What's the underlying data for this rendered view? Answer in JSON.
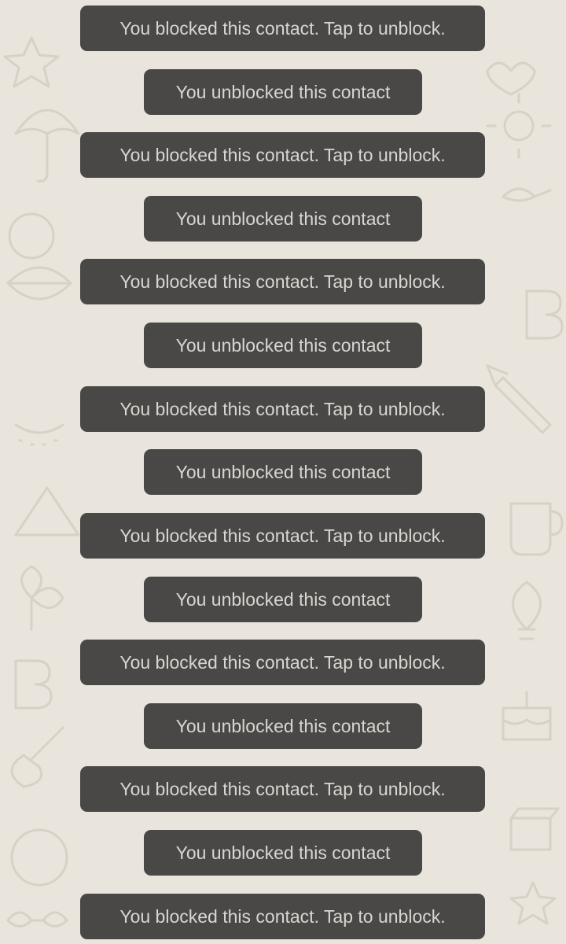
{
  "chat": {
    "background_color": "#e9e4dc",
    "bubble_color": "#4a4846",
    "bubble_text_color": "#d9d6d1",
    "messages": [
      {
        "text": "You blocked this contact. Tap to unblock.",
        "kind": "blocked"
      },
      {
        "text": "You unblocked this contact",
        "kind": "unblocked"
      },
      {
        "text": "You blocked this contact. Tap to unblock.",
        "kind": "blocked"
      },
      {
        "text": "You unblocked this contact",
        "kind": "unblocked"
      },
      {
        "text": "You blocked this contact. Tap to unblock.",
        "kind": "blocked"
      },
      {
        "text": "You unblocked this contact",
        "kind": "unblocked"
      },
      {
        "text": "You blocked this contact. Tap to unblock.",
        "kind": "blocked"
      },
      {
        "text": "You unblocked this contact",
        "kind": "unblocked"
      },
      {
        "text": "You blocked this contact. Tap to unblock.",
        "kind": "blocked"
      },
      {
        "text": "You unblocked this contact",
        "kind": "unblocked"
      },
      {
        "text": "You blocked this contact. Tap to unblock.",
        "kind": "blocked"
      },
      {
        "text": "You unblocked this contact",
        "kind": "unblocked"
      },
      {
        "text": "You blocked this contact. Tap to unblock.",
        "kind": "blocked"
      },
      {
        "text": "You unblocked this contact",
        "kind": "unblocked"
      },
      {
        "text": "You blocked this contact. Tap to unblock.",
        "kind": "blocked"
      }
    ]
  }
}
